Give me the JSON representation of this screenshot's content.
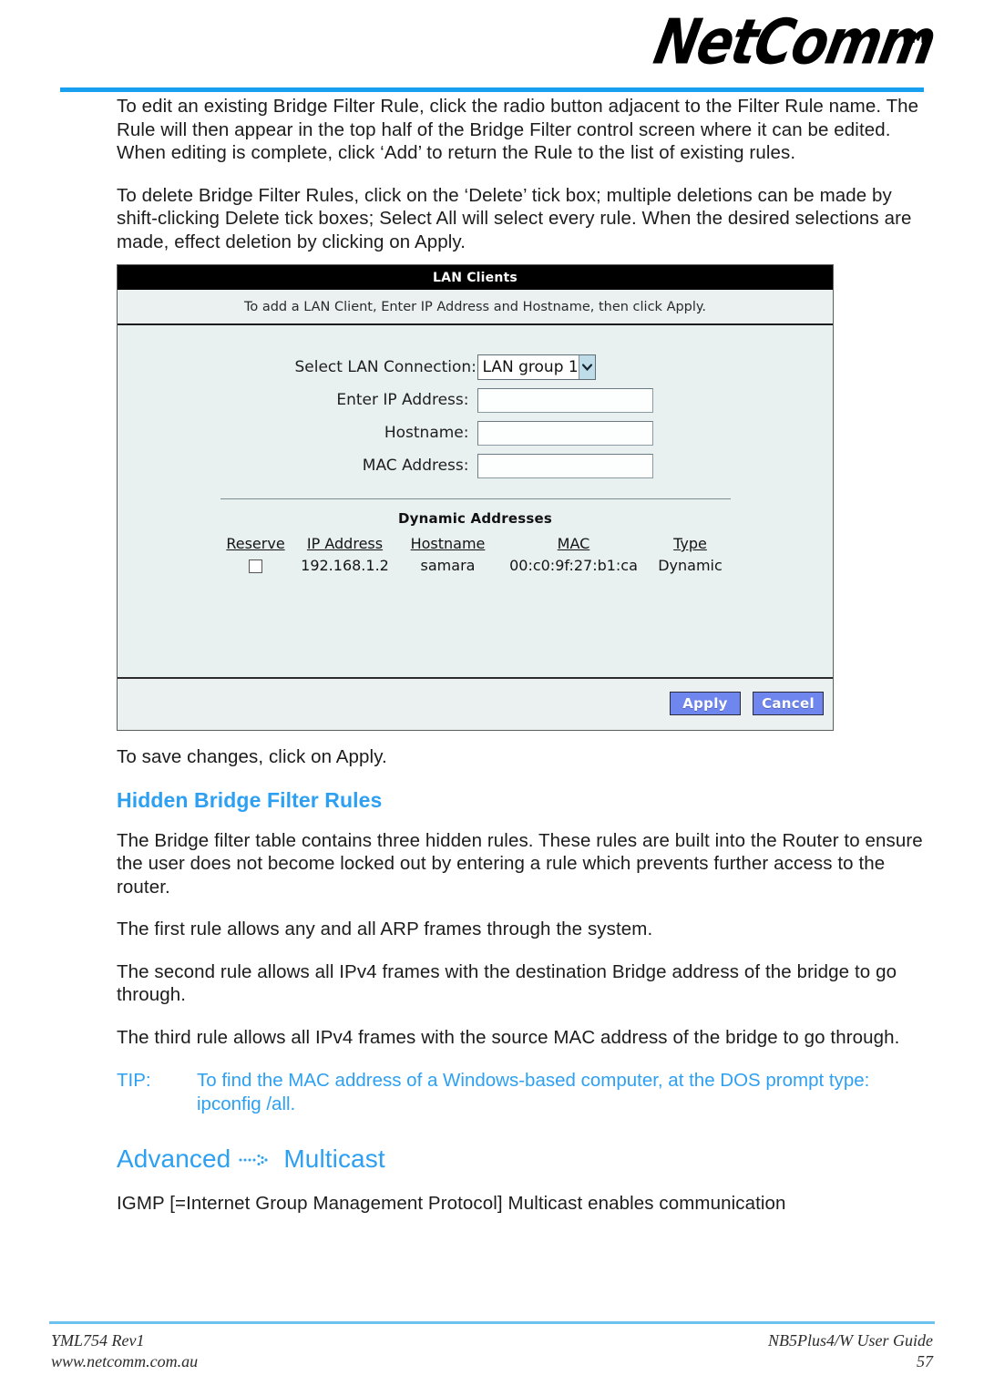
{
  "header": {
    "logo_text": "NetComm",
    "trademark": "TM",
    "rule_color": "#199ff0"
  },
  "body": {
    "paragraph_1": "To edit an existing Bridge Filter Rule, click the radio button adjacent to the Filter Rule name.  The Rule will then appear in the top half of the Bridge Filter control screen where it can be edited. When editing is complete, click ‘Add’ to return the Rule to the list of existing rules.",
    "paragraph_2": "To delete Bridge Filter Rules, click on the ‘Delete’ tick box; multiple deletions can be made by shift-clicking Delete tick boxes; Select All will select every rule.  When the desired selections are made, effect deletion by clicking on Apply."
  },
  "screenshot_panel": {
    "title": "LAN Clients",
    "instruction": "To add a LAN Client, Enter IP Address and Hostname, then click Apply.",
    "form": {
      "lan_connection_label": "Select LAN Connection:",
      "lan_connection_value": "LAN group 1",
      "lan_connection_options": [
        "LAN group 1"
      ],
      "ip_address_label": "Enter IP Address:",
      "ip_address_value": "",
      "hostname_label": "Hostname:",
      "hostname_value": "",
      "mac_address_label": "MAC Address:",
      "mac_address_value": ""
    },
    "dynamic_addresses": {
      "title": "Dynamic Addresses",
      "columns": [
        "Reserve",
        "IP Address",
        "Hostname",
        "MAC",
        "Type"
      ],
      "rows": [
        {
          "reserve_checked": false,
          "ip_address": "192.168.1.2",
          "hostname": "samara",
          "mac": "00:c0:9f:27:b1:ca",
          "type": "Dynamic"
        }
      ]
    },
    "buttons": {
      "apply": "Apply",
      "cancel": "Cancel",
      "button_color": "#6e86ee"
    }
  },
  "lower": {
    "save_note": "To save changes, click on Apply.",
    "hidden_rules_heading": "Hidden Bridge Filter Rules",
    "hidden_rules_p1": "The Bridge filter table contains three hidden rules. These rules are built into the Router to ensure the user does not become locked out by entering a rule which prevents further access to the router.",
    "hidden_rules_p2": "The first rule allows any and all ARP frames through the system.",
    "hidden_rules_p3": "The second rule allows all IPv4 frames with the destination Bridge address of the bridge to go through.",
    "hidden_rules_p4": "The third rule allows all IPv4 frames with the source MAC address of the bridge to go through.",
    "tip_label": "TIP:",
    "tip_text": "To find the MAC address of a Windows-based computer, at the DOS prompt type: ipconfig /all.",
    "advanced_heading_part1": "Advanced",
    "advanced_heading_arrow": "dotted-arrow-icon",
    "advanced_heading_part2": "Multicast",
    "multicast_intro": "IGMP [=Internet Group Management Protocol] Multicast enables communication",
    "accent_color": "#2da0f2"
  },
  "footer": {
    "doc_code": "YML754 Rev1",
    "website": "www.netcomm.com.au",
    "guide_title": "NB5Plus4/W User Guide",
    "page_number": "57",
    "rule_color": "#6cc1ef"
  }
}
